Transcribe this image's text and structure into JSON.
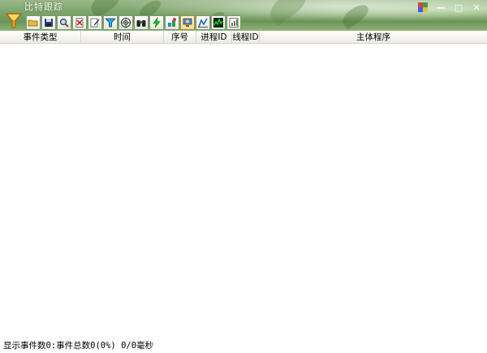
{
  "window": {
    "title": "比特跟踪",
    "controls": [
      "minimize-icon",
      "maximize-icon",
      "close-icon"
    ]
  },
  "toolbar": {
    "icons": [
      "open-folder-icon",
      "save-disk-icon",
      "magnifier-icon",
      "delete-document-icon",
      "edit-document-icon",
      "filter-funnel-icon",
      "target-icon",
      "binoculars-icon",
      "green-lightning-icon",
      "process-tool-icon",
      "monitor-active-icon",
      "chart-icon",
      "activity-graph-icon",
      "report-icon"
    ],
    "active_index": 10
  },
  "columns": [
    "事件类型",
    "时间",
    "序号",
    "进程ID",
    "线程ID",
    "主体程序"
  ],
  "rows": [],
  "status": {
    "text": "显示事件数0:事件总数0(0%) 0/0毫秒"
  }
}
